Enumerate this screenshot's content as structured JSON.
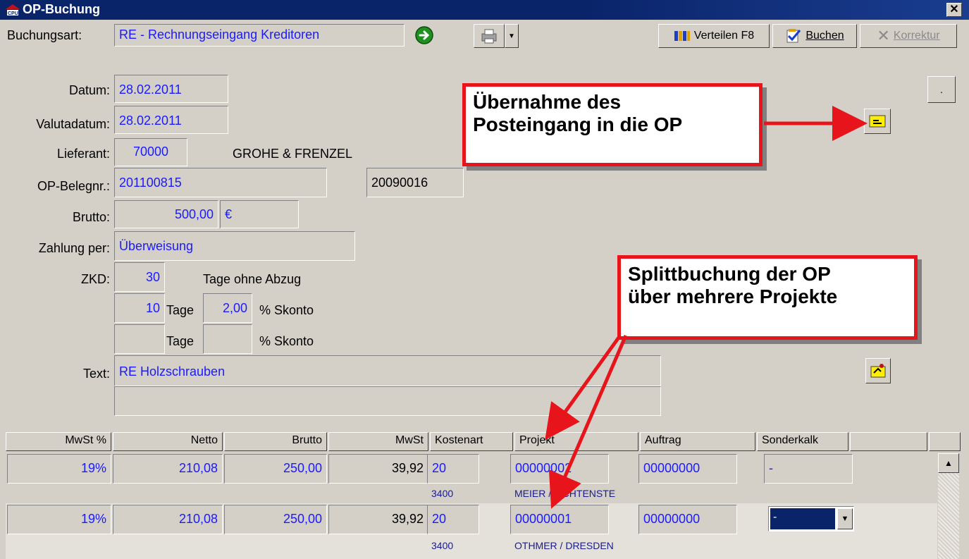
{
  "window": {
    "title": "OP-Buchung",
    "close": "✕"
  },
  "toolbar": {
    "buchungsart_label": "Buchungsart:",
    "buchungsart_value": "RE - Rechnungseingang Kreditoren",
    "verteilen": "Verteilen F8",
    "buchen": "Buchen",
    "korrektur": "Korrektur"
  },
  "form": {
    "datum_label": "Datum:",
    "datum": "28.02.2011",
    "valuta_label": "Valutadatum:",
    "valuta": "28.02.2011",
    "lieferant_label": "Lieferant:",
    "lieferant_nr": "70000",
    "lieferant_name": "GROHE & FRENZEL",
    "belegnr_label": "OP-Belegnr.:",
    "belegnr": "201100815",
    "belegnr2": "20090016",
    "brutto_label": "Brutto:",
    "brutto": "500,00",
    "currency": "€",
    "zahlung_label": "Zahlung per:",
    "zahlung": "Überweisung",
    "zkd_label": "ZKD:",
    "zkd_days": "30",
    "zkd_text": "Tage ohne Abzug",
    "skonto1_days": "10",
    "skonto1_pct": "2,00",
    "tage": "Tage",
    "skonto_text": "% Skonto",
    "skonto2_days": "",
    "skonto2_pct": "",
    "text_label": "Text:",
    "text1": "RE Holzschrauben",
    "text2": ""
  },
  "grid": {
    "headers": [
      "MwSt %",
      "Netto",
      "Brutto",
      "MwSt",
      "Kostenart",
      "Projekt",
      "Auftrag",
      "Sonderkalk"
    ],
    "rows": [
      {
        "mwst_pct": "19%",
        "netto": "210,08",
        "brutto": "250,00",
        "mwst": "39,92",
        "kostenart": "20",
        "kostenart_sub": "3400",
        "projekt": "00000002",
        "projekt_sub": "MEIER / LICHTENSTE",
        "auftrag": "00000000",
        "sonderkalk": "-"
      },
      {
        "mwst_pct": "19%",
        "netto": "210,08",
        "brutto": "250,00",
        "mwst": "39,92",
        "kostenart": "20",
        "kostenart_sub": "3400",
        "projekt": "00000001",
        "projekt_sub": "OTHMER / DRESDEN",
        "auftrag": "00000000",
        "sonderkalk": "-"
      }
    ]
  },
  "annotations": {
    "callout1_line1": "Übernahme des",
    "callout1_line2": "Posteingang in die OP",
    "callout2_line1": "Splittbuchung der OP",
    "callout2_line2": "über mehrere Projekte"
  },
  "colors": {
    "value_text": "#1a1aff",
    "titlebar": "#0a246a",
    "callout_border": "#e8141c",
    "arrow": "#e8141c"
  },
  "icons": [
    "app-icon",
    "go-arrow-icon",
    "printer-icon",
    "chevron-down-icon",
    "verteilen-icon",
    "buchen-icon",
    "korrektur-x-icon",
    "posteingang-icon",
    "edit-icon",
    "scroll-up-icon"
  ]
}
